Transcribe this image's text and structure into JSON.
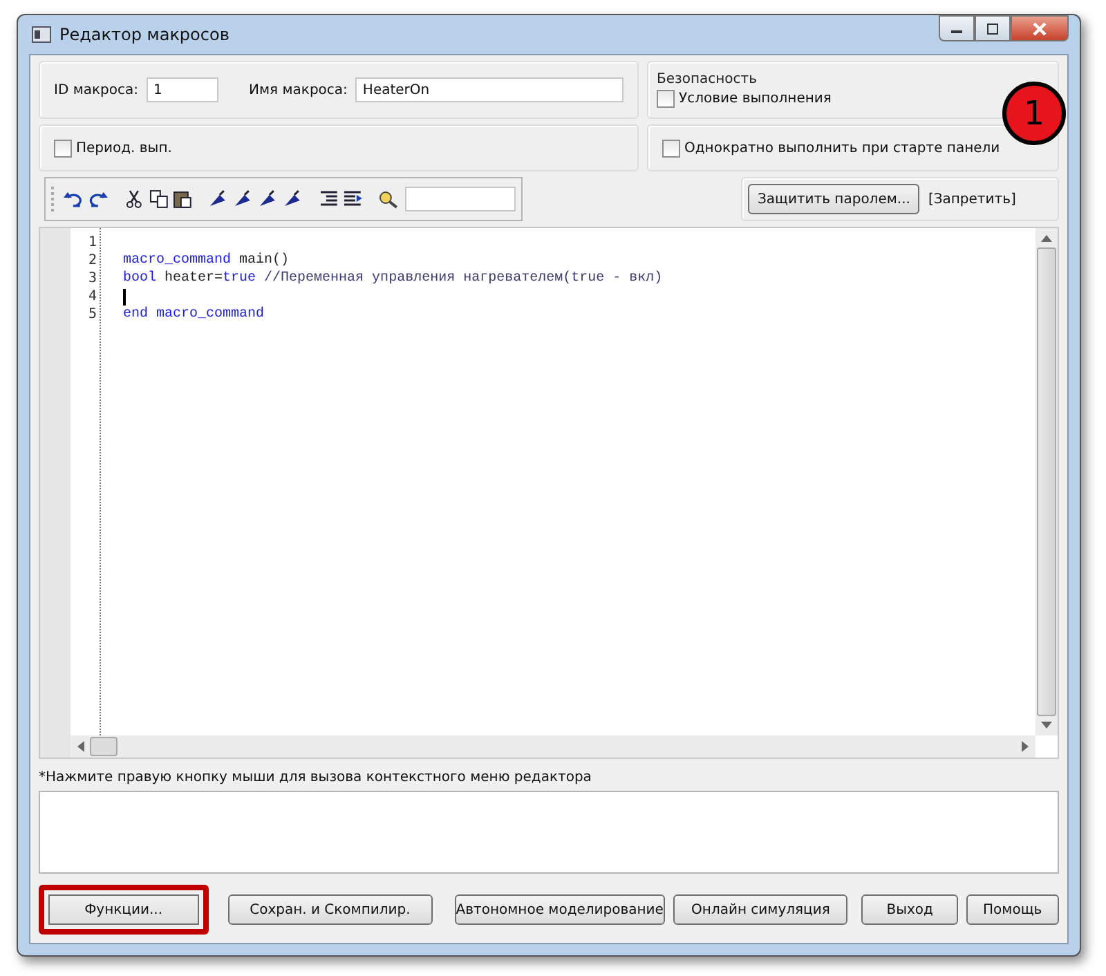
{
  "window": {
    "title": "Редактор макросов"
  },
  "macro": {
    "id_label": "ID макроса:",
    "id_value": "1",
    "name_label": "Имя макроса:",
    "name_value": "HeaterOn"
  },
  "security": {
    "title": "Безопасность",
    "condition": {
      "label": "Условие выполнения",
      "checked": false
    }
  },
  "periodic": {
    "label": "Период. вып.",
    "checked": false
  },
  "run_once": {
    "label": "Однократно выполнить при старте панели",
    "checked": false
  },
  "protect": {
    "button": "Защитить паролем...",
    "status": "[Запретить]"
  },
  "editor": {
    "lines": [
      {
        "number": "1"
      },
      {
        "number": "2",
        "tokens": [
          {
            "kind": "keyword",
            "text": "macro_command"
          },
          {
            "kind": "plain",
            "text": " main()"
          }
        ]
      },
      {
        "number": "3",
        "tokens": [
          {
            "kind": "keyword",
            "text": "bool"
          },
          {
            "kind": "plain",
            "text": " heater="
          },
          {
            "kind": "keyword",
            "text": "true"
          },
          {
            "kind": "comment",
            "text": " //Переменная управления нагревателем(true - вкл)"
          }
        ]
      },
      {
        "number": "4",
        "cursor": true
      },
      {
        "number": "5",
        "tokens": [
          {
            "kind": "keyword",
            "text": "end"
          },
          {
            "kind": "keyword",
            "text": " macro_command"
          }
        ]
      }
    ]
  },
  "hint": "*Нажмите правую кнопку мыши для вызова контекстного меню редактора",
  "buttons": [
    {
      "label": "Функции...",
      "highlighted": true
    },
    {
      "label": "Сохран. и Скомпилир.",
      "highlighted": false
    },
    {
      "label": "Автономное моделирование",
      "highlighted": false
    },
    {
      "label": "Онлайн симуляция",
      "highlighted": false
    },
    {
      "label": "Выход",
      "highlighted": false
    },
    {
      "label": "Помощь",
      "highlighted": false
    }
  ],
  "callout": "1"
}
